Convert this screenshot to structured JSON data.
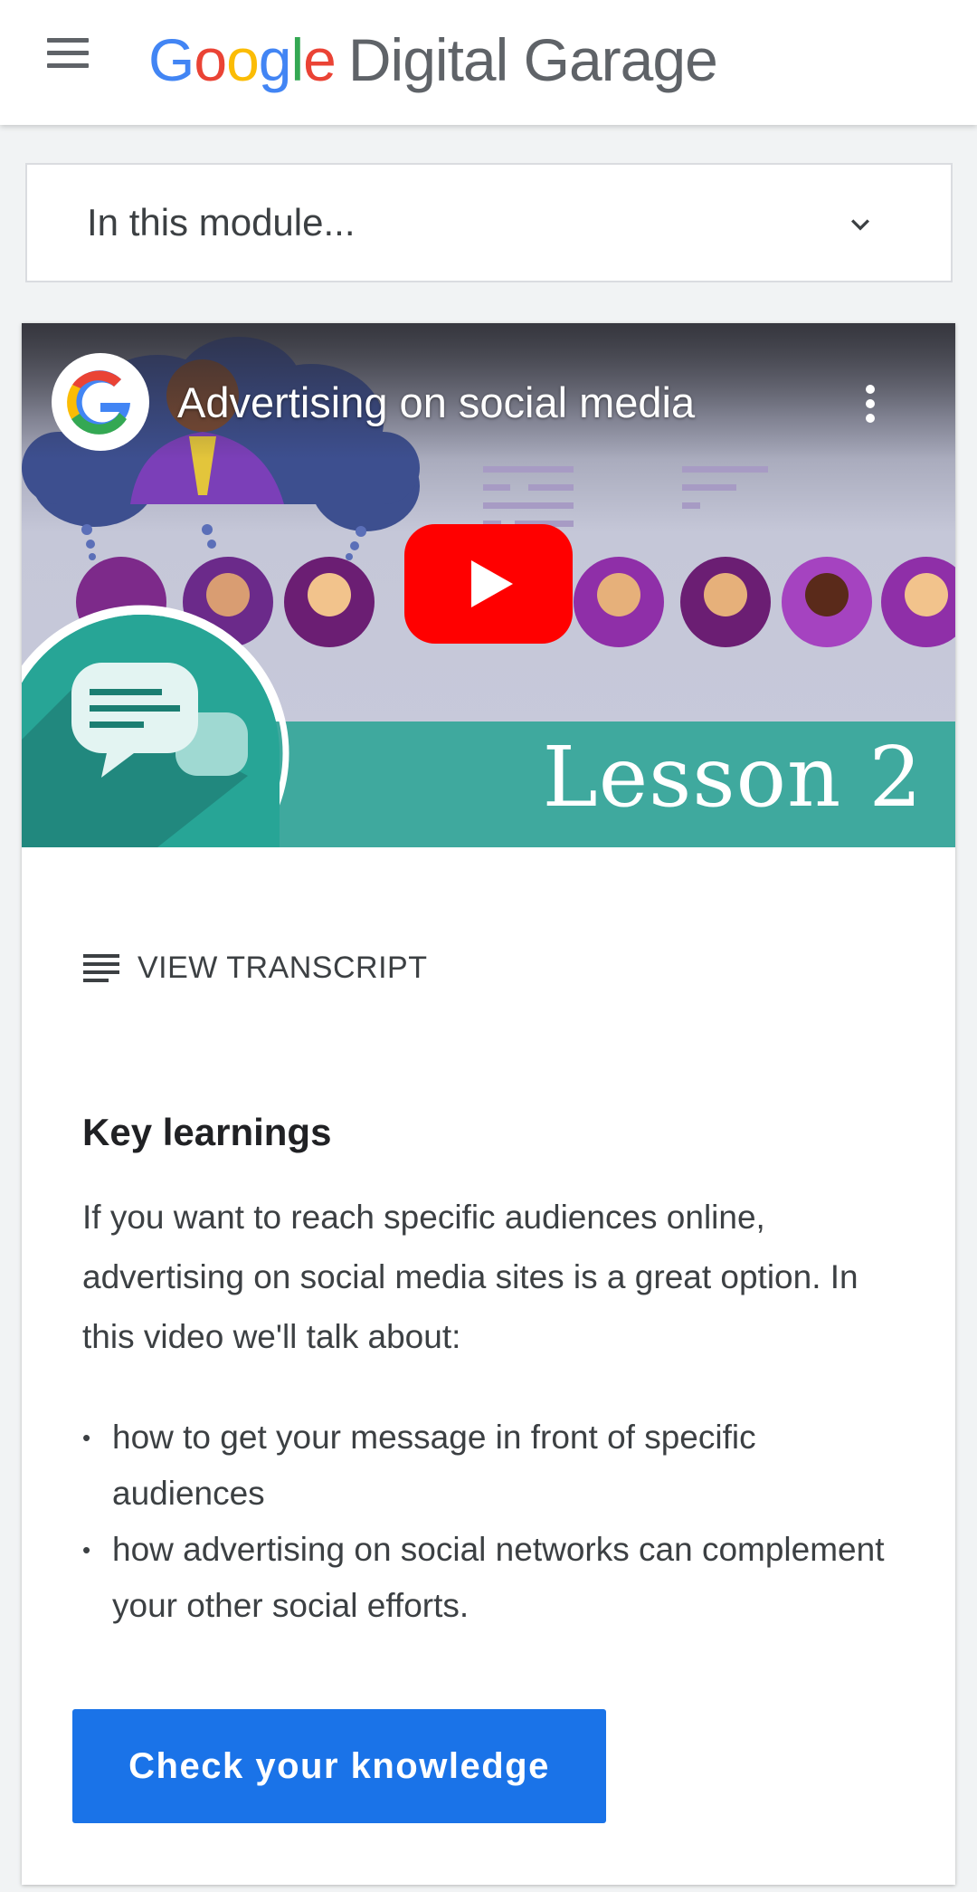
{
  "header": {
    "menu_icon": "hamburger-menu-icon",
    "logo": {
      "letters": [
        "G",
        "o",
        "o",
        "g",
        "l",
        "e"
      ],
      "product": "Digital Garage"
    }
  },
  "module_selector": {
    "label": "In this module...",
    "icon": "chevron-down-icon"
  },
  "video": {
    "title": "Advertising on social media",
    "thumbnail_text": "Lesson 2",
    "channel_icon": "google-g-icon",
    "more_icon": "more-vert-icon",
    "play_icon": "youtube-play-icon"
  },
  "transcript": {
    "icon": "notes-icon",
    "label": "VIEW TRANSCRIPT"
  },
  "key_learnings": {
    "title": "Key learnings",
    "body": "If you want to reach specific audiences online, advertising on social media sites is a great option. In this video we'll talk about:",
    "items": [
      "how to get your message in front of specific audiences",
      "how advertising on social networks can complement your other social efforts."
    ]
  },
  "cta": {
    "label": "Check your knowledge"
  },
  "colors": {
    "primary": "#1a73e8",
    "teal": "#3fa99e",
    "youtube_red": "#ff0000"
  }
}
